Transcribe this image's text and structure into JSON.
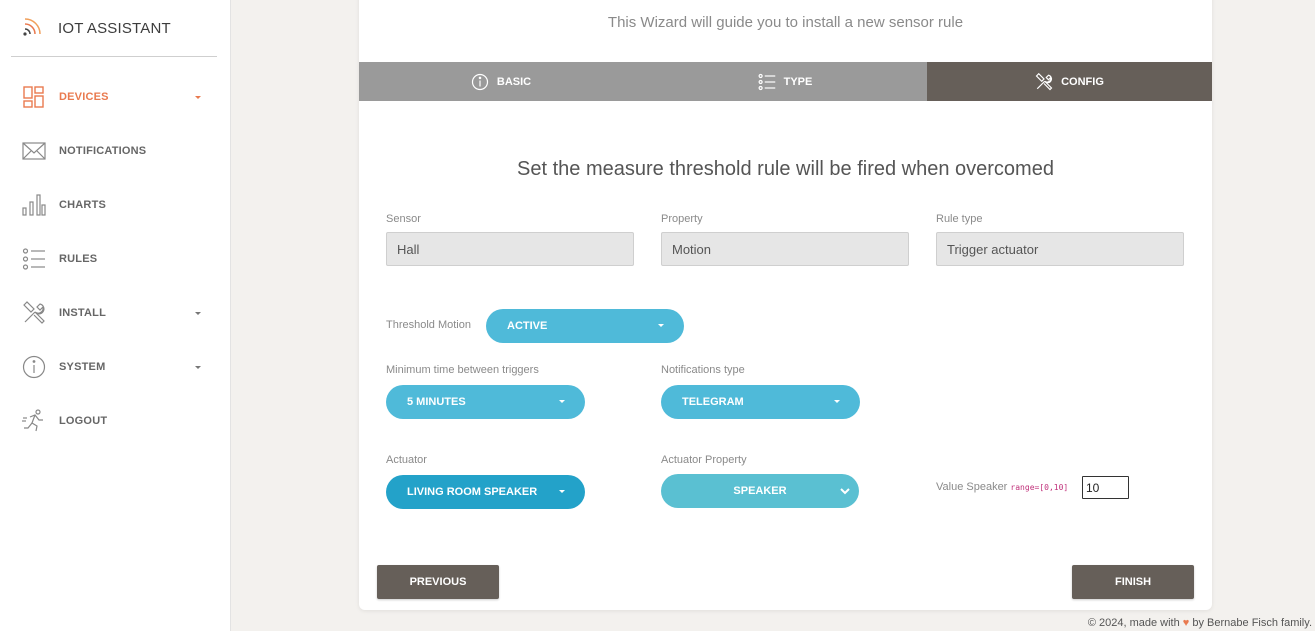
{
  "app": {
    "title": "IOT ASSISTANT"
  },
  "sidebar": {
    "items": [
      {
        "label": "DEVICES",
        "icon": "dashboard-icon",
        "active": true,
        "caret": true
      },
      {
        "label": "NOTIFICATIONS",
        "icon": "envelope-icon",
        "active": false,
        "caret": false
      },
      {
        "label": "CHARTS",
        "icon": "bar-chart-icon",
        "active": false,
        "caret": false
      },
      {
        "label": "RULES",
        "icon": "list-icon",
        "active": false,
        "caret": false
      },
      {
        "label": "INSTALL",
        "icon": "tools-icon",
        "active": false,
        "caret": true
      },
      {
        "label": "SYSTEM",
        "icon": "info-icon",
        "active": false,
        "caret": true
      },
      {
        "label": "LOGOUT",
        "icon": "running-icon",
        "active": false,
        "caret": false
      }
    ]
  },
  "wizard": {
    "subtitle": "This Wizard will guide you to install a new sensor rule",
    "tabs": [
      {
        "label": "BASIC",
        "icon": "info-icon",
        "active": false
      },
      {
        "label": "TYPE",
        "icon": "list-icon",
        "active": false
      },
      {
        "label": "CONFIG",
        "icon": "tools-icon",
        "active": true
      }
    ],
    "heading": "Set the measure threshold rule will be fired when overcomed",
    "sensor": {
      "label": "Sensor",
      "value": "Hall"
    },
    "property": {
      "label": "Property",
      "value": "Motion"
    },
    "rule_type": {
      "label": "Rule type",
      "value": "Trigger actuator"
    },
    "threshold": {
      "label": "Threshold Motion",
      "value": "ACTIVE"
    },
    "min_time": {
      "label": "Minimum time between triggers",
      "value": "5 MINUTES"
    },
    "notifications_type": {
      "label": "Notifications type",
      "value": "TELEGRAM"
    },
    "actuator": {
      "label": "Actuator",
      "value": "LIVING ROOM SPEAKER"
    },
    "actuator_property": {
      "label": "Actuator Property",
      "value": "SPEAKER"
    },
    "value_speaker": {
      "label": "Value Speaker",
      "range": "range=[0,10]",
      "value": "10"
    },
    "previous_label": "PREVIOUS",
    "finish_label": "FINISH"
  },
  "footer": {
    "prefix": "© 2024, made with",
    "heart": "♥",
    "suffix": "by Bernabe Fisch family."
  },
  "colors": {
    "accent": "#e97a4f",
    "tab_active": "#665f59",
    "tab_inactive": "#9a9a9a",
    "pill": "#4fbad9"
  }
}
